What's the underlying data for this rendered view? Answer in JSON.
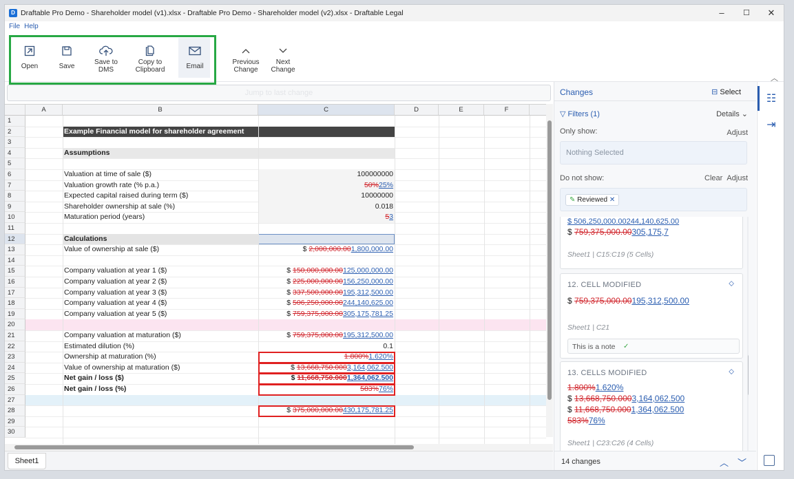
{
  "window": {
    "title": "Draftable Pro Demo - Shareholder model (v1).xlsx - Draftable Pro Demo - Shareholder model (v2).xlsx - Draftable Legal",
    "min": "–",
    "max": "☐",
    "close": "✕"
  },
  "menu": {
    "file": "File",
    "help": "Help"
  },
  "toolbar": {
    "open": "Open",
    "save": "Save",
    "save_dms": [
      "Save to",
      "DMS"
    ],
    "copy": [
      "Copy to",
      "Clipboard"
    ],
    "email": "Email",
    "prev": [
      "Previous",
      "Change"
    ],
    "next": [
      "Next",
      "Change"
    ]
  },
  "jump_bar": "Jump to last change",
  "columns": [
    "A",
    "B",
    "C",
    "D",
    "E",
    "F"
  ],
  "rows": [
    "1",
    "2",
    "3",
    "4",
    "5",
    "6",
    "7",
    "8",
    "9",
    "10",
    "11",
    "12",
    "13",
    "14",
    "15",
    "16",
    "17",
    "18",
    "19",
    "20",
    "21",
    "22",
    "23",
    "24",
    "25",
    "26",
    "27",
    "28",
    "29",
    "30"
  ],
  "cells": {
    "r2b": "Example Financial model for shareholder agreement",
    "r4b": "Assumptions",
    "r6b": "Valuation at time of sale ($)",
    "r6c": "100000000",
    "r7b": "Valuation growth rate (% p.a.)",
    "r7d": "50%",
    "r7i": "25%",
    "r8b": "Expected capital raised during term ($)",
    "r8c": "10000000",
    "r9b": "Shareholder ownership at sale (%)",
    "r9c": "0.018",
    "r10b": "Maturation period (years)",
    "r10d": "5",
    "r10i": "3",
    "r12b": "Calculations",
    "r13b": "Value of ownership at sale ($)",
    "r13p": "$ ",
    "r13d": "2,000,000.00",
    "r13i": "1,800,000.00",
    "r15b": "Company valuation at year 1 ($)",
    "r15p": "$ ",
    "r15d": "150,000,000.00",
    "r15i": "125,000,000.00",
    "r16b": "Company valuation at year 2 ($)",
    "r16p": "$ ",
    "r16d": "225,000,000.00",
    "r16i": "156,250,000.00",
    "r17b": "Company valuation at year 3 ($)",
    "r17p": "$ ",
    "r17d": "337,500,000.00",
    "r17i": "195,312,500.00",
    "r18b": "Company valuation at year 4 ($)",
    "r18p": "$ ",
    "r18d": "506,250,000.00",
    "r18i": "244,140,625.00",
    "r19b": "Company valuation at year 5 ($)",
    "r19p": "$ ",
    "r19d": "759,375,000.00",
    "r19i": "305,175,781.25",
    "r21b": "Company valuation at maturation ($)",
    "r21p": "$ ",
    "r21d": "759,375,000.00",
    "r21i": "195,312,500.00",
    "r22b": "Estimated dilution (%)",
    "r22c": "0.1",
    "r23b": "Ownership at maturation (%)",
    "r23d": "1.800%",
    "r23i": "1.620%",
    "r24b": "Value of ownership at maturation ($)",
    "r24p": "$ ",
    "r24d": "13,668,750.000",
    "r24i": "3,164,062.500",
    "r25b": "Net gain / loss ($)",
    "r25p": "$ ",
    "r25d": "11,668,750.000",
    "r25i": "1,364,062.500",
    "r26b": "Net gain / loss (%)",
    "r26d": "583%",
    "r26i": "76%",
    "r28p": "$ ",
    "r28d": "375,000,000.00",
    "r28i": "430,175,781.25"
  },
  "sheet_tab": "Sheet1",
  "panel": {
    "title": "Changes",
    "select": "Select",
    "filters": "Filters (1)",
    "details": "Details",
    "only_show": "Only show:",
    "adjust": "Adjust",
    "nothing_selected": "Nothing Selected",
    "do_not_show": "Do not show:",
    "clear": "Clear",
    "reviewed_chip": "Reviewed",
    "card11": {
      "partial": "$ 506,250,000.00244,140,625.00",
      "prefix": "$ ",
      "del": "759,375,000.00",
      "ins": "305,175,7",
      "meta": "Sheet1 | C15:C19 (5 Cells)"
    },
    "card12": {
      "heading": "12. CELL MODIFIED",
      "prefix": "$ ",
      "del": "759,375,000.00",
      "ins": "195,312,500.00",
      "meta": "Sheet1 | C21",
      "note": "This is a note"
    },
    "card13": {
      "heading": "13. CELLS MODIFIED",
      "l1d": "1.800%",
      "l1i": "1.620%",
      "l2p": "$ ",
      "l2d": "13,668,750.000",
      "l2i": "3,164,062.500",
      "l3p": "$ ",
      "l3d": "11,668,750.000",
      "l3i": "1,364,062.500",
      "l4d": "583%",
      "l4i": "76%",
      "meta": "Sheet1 | C23:C26 (4 Cells)"
    },
    "count": "14 changes"
  }
}
